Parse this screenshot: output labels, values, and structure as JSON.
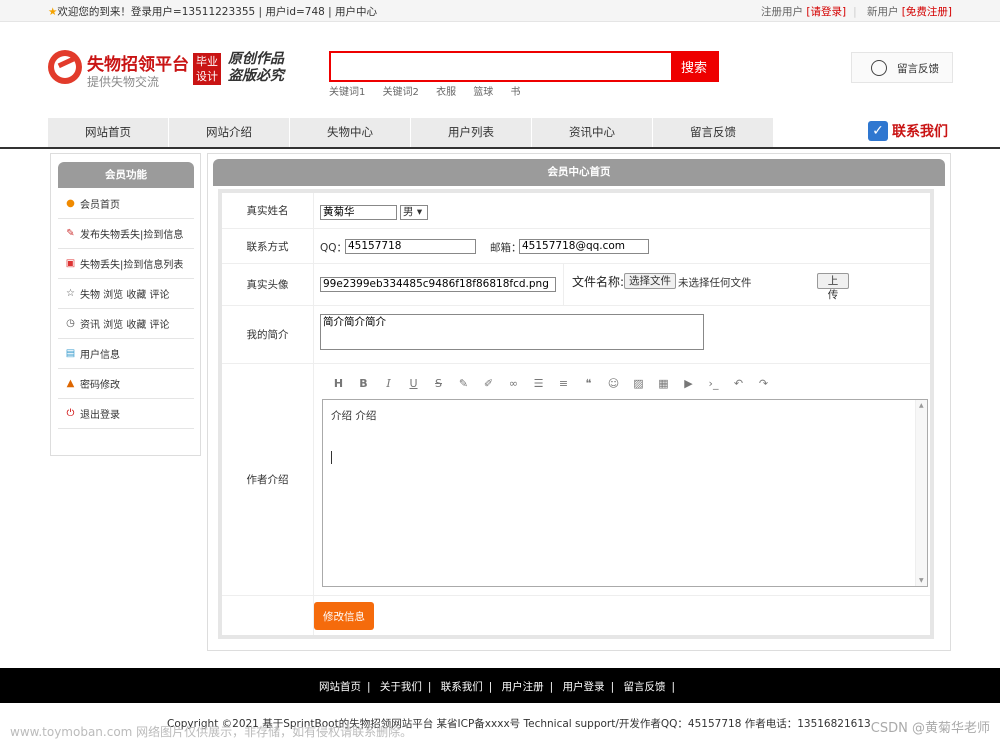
{
  "topbar": {
    "welcome": "欢迎您的到来！登录用户=13511223355 | 用户id=748 | 用户中心",
    "register_user": "注册用户",
    "login_link": "[请登录]",
    "new_user": "新用户",
    "free_register": "[免费注册]"
  },
  "header": {
    "logo_title": "失物招领平台",
    "logo_sub": "提供失物交流",
    "badge": "毕业设计",
    "slogan_line1": "原创作品",
    "slogan_line2": "盗版必究",
    "search_placeholder": "",
    "search_button": "搜索",
    "keywords": [
      "关键词1",
      "关键词2",
      "衣服",
      "篮球",
      "书"
    ],
    "feedback": "留言反馈"
  },
  "nav": {
    "items": [
      "网站首页",
      "网站介绍",
      "失物中心",
      "用户列表",
      "资讯中心",
      "留言反馈"
    ],
    "contact": "联系我们"
  },
  "sidebar": {
    "title": "会员功能",
    "items": [
      "会员首页",
      "发布失物丢失|捡到信息",
      "失物丢失|捡到信息列表",
      "失物 浏览 收藏 评论",
      "资讯 浏览 收藏 评论",
      "用户信息",
      "密码修改",
      "退出登录"
    ]
  },
  "main": {
    "title": "会员中心首页",
    "real_name_label": "真实姓名",
    "real_name_value": "黄菊华",
    "gender": "男",
    "contact_label": "联系方式",
    "qq_label": "QQ：",
    "qq_value": "45157718",
    "email_label": "邮箱：",
    "email_value": "45157718@qq.com",
    "avatar_label": "真实头像",
    "avatar_value": "99e2399eb334485c9486f18f86818fcd.png",
    "file_name_label": "文件名称:",
    "choose_file": "选择文件",
    "no_file": "未选择任何文件",
    "upload": "上 传",
    "intro_label": "我的简介",
    "intro_value": "简介简介简介",
    "author_label": "作者介绍",
    "editor_content": "介绍 介绍",
    "submit": "修改信息"
  },
  "footer": {
    "links": [
      "网站首页",
      "关于我们",
      "联系我们",
      "用户注册",
      "用户登录",
      "留言反馈"
    ],
    "copyright": "Copyright ©2021 基于SprintBoot的失物招领网站平台   某省ICP备xxxx号   Technical support/开发作者QQ：45157718    作者电话：13516821613",
    "watermark_left": "www.toymoban.com 网络图片仅供展示，非存储，如有侵权请联系删除。",
    "watermark_right": "CSDN @黄菊华老师"
  }
}
